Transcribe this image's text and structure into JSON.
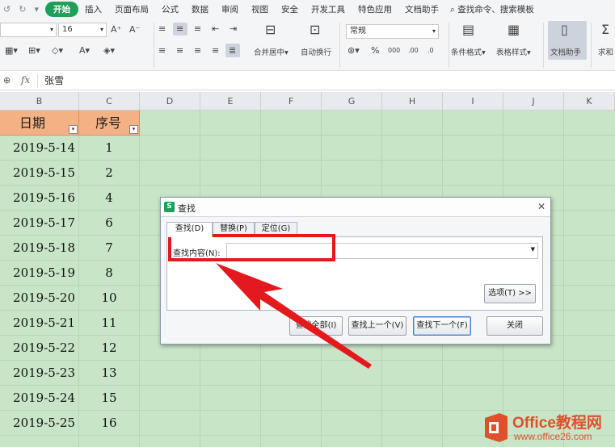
{
  "ribbon": {
    "quick_access": [
      "↺",
      "↻",
      "▾"
    ],
    "tabs": [
      "开始",
      "插入",
      "页面布局",
      "公式",
      "数据",
      "审阅",
      "视图",
      "安全",
      "开发工具",
      "特色应用",
      "文档助手"
    ],
    "active_tab": "开始",
    "search_label": "查找命令、搜索模板",
    "font_size": "16",
    "number_format": "常规",
    "labels": {
      "merge": "合并居中",
      "wrap": "自动换行",
      "cond_format": "条件格式",
      "table_style": "表格样式",
      "doc_helper": "文档助手",
      "sum": "求和"
    }
  },
  "formula_bar": {
    "fx": "fx",
    "value": "张雪"
  },
  "sheet": {
    "columns": [
      "B",
      "C",
      "D",
      "E",
      "F",
      "G",
      "H",
      "I",
      "J",
      "K"
    ],
    "header": {
      "date": "日期",
      "seq": "序号"
    },
    "rows": [
      {
        "date": "2019-5-14",
        "seq": "1"
      },
      {
        "date": "2019-5-15",
        "seq": "2"
      },
      {
        "date": "2019-5-16",
        "seq": "4"
      },
      {
        "date": "2019-5-17",
        "seq": "6"
      },
      {
        "date": "2019-5-18",
        "seq": "7"
      },
      {
        "date": "2019-5-19",
        "seq": "8"
      },
      {
        "date": "2019-5-20",
        "seq": "10"
      },
      {
        "date": "2019-5-21",
        "seq": "11"
      },
      {
        "date": "2019-5-22",
        "seq": "12"
      },
      {
        "date": "2019-5-23",
        "seq": "13"
      },
      {
        "date": "2019-5-24",
        "seq": "15"
      },
      {
        "date": "2019-5-25",
        "seq": "16"
      }
    ]
  },
  "dialog": {
    "logo": "S",
    "title": "查找",
    "tabs": [
      "查找(D)",
      "替换(P)",
      "定位(G)"
    ],
    "find_label": "查找内容(N):",
    "find_value": "",
    "options_button": "选项(T) >>",
    "buttons": {
      "find_all": "查找全部(I)",
      "find_prev": "查找上一个(V)",
      "find_next": "查找下一个(F)",
      "close": "关闭"
    }
  },
  "watermark": {
    "title": "Office教程网",
    "url": "www.office26.com"
  },
  "colors": {
    "accent_green": "#1e9f5a",
    "header_orange": "#f4b183",
    "cell_green": "#c8e5c7",
    "annotation_red": "#e4191e"
  }
}
